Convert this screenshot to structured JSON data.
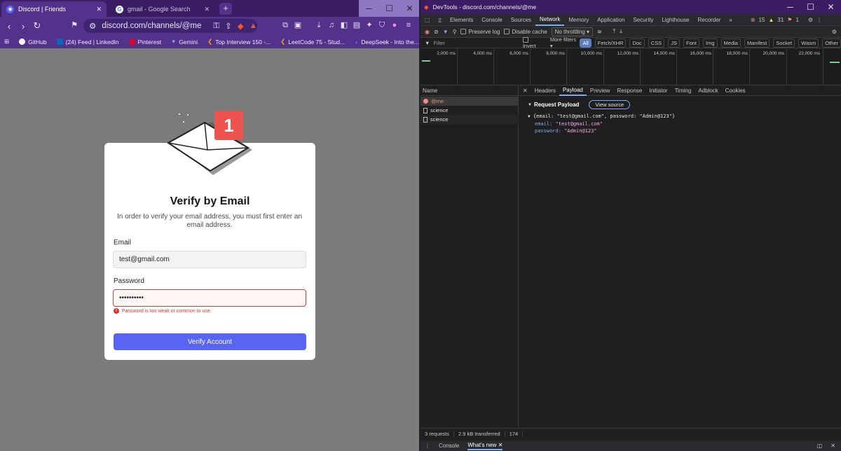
{
  "browser": {
    "tabs": [
      {
        "title": "Discord | Friends",
        "icon": "discord-icon"
      },
      {
        "title": "gmail - Google Search",
        "icon": "google-icon"
      }
    ],
    "address": "discord.com/channels/@me",
    "bookmarks": [
      "GitHub",
      "(24) Feed | LinkedIn",
      "Pinterest",
      "Gemini",
      "Top Interview 150 -...",
      "LeetCode 75 - Stud...",
      "DeepSeek - Into the..."
    ]
  },
  "page": {
    "badge": "1",
    "title": "Verify by Email",
    "description": "In order to verify your email address, you must first enter an email address.",
    "email_label": "Email",
    "email_value": "test@gmail.com",
    "password_label": "Password",
    "password_value": "••••••••••",
    "error": "Password is too weak or common to use.",
    "submit": "Verify Account"
  },
  "devtools": {
    "title": "DevTools - discord.com/channels/@me",
    "tabs": [
      "Elements",
      "Console",
      "Sources",
      "Network",
      "Memory",
      "Application",
      "Security",
      "Lighthouse",
      "Recorder"
    ],
    "counts": {
      "errors": "15",
      "warnings": "31",
      "issues": "1"
    },
    "netbar": {
      "preserve": "Preserve log",
      "disable_cache": "Disable cache",
      "throttle": "No throttling"
    },
    "filter": {
      "placeholder": "Filter",
      "invert": "Invert",
      "more": "More filters",
      "types": [
        "All",
        "Fetch/XHR",
        "Doc",
        "CSS",
        "JS",
        "Font",
        "Img",
        "Media",
        "Manifest",
        "Socket",
        "Wasm",
        "Other"
      ]
    },
    "timeline_ticks": [
      "2,000 ms",
      "4,000 ms",
      "6,000 ms",
      "8,000 ms",
      "10,000 ms",
      "12,000 ms",
      "14,000 ms",
      "16,000 ms",
      "18,000 ms",
      "20,000 ms",
      "22,000 ms"
    ],
    "name_header": "Name",
    "requests": [
      "@me",
      "science",
      "science"
    ],
    "panel_tabs": [
      "Headers",
      "Payload",
      "Preview",
      "Response",
      "Initiator",
      "Timing",
      "Adblock",
      "Cookies"
    ],
    "payload": {
      "heading": "Request Payload",
      "view_source": "View source",
      "summary": "{email: \"test@gmail.com\", password: \"Admin@123\"}",
      "email_key": "email:",
      "email_val": "\"test@gmail.com\"",
      "password_key": "password:",
      "password_val": "\"Admin@123\""
    },
    "status": {
      "requests": "3 requests",
      "transferred": "2.9 kB transferred",
      "extra": "174"
    },
    "drawer": {
      "console": "Console",
      "whats_new": "What's new"
    }
  }
}
